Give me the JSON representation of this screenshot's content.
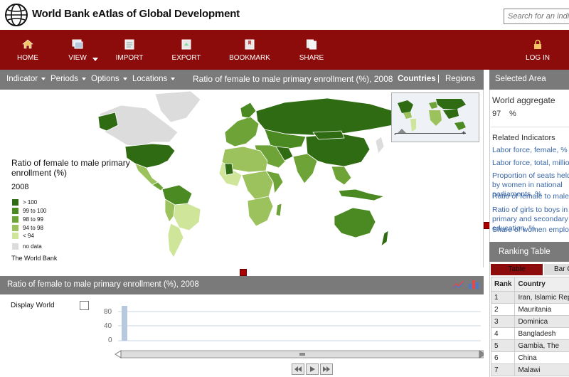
{
  "app": {
    "title": "World Bank eAtlas of Global Development",
    "search_placeholder": "Search for an indicator"
  },
  "toolbar": {
    "home": "HOME",
    "view": "VIEW",
    "import": "IMPORT",
    "export": "EXPORT",
    "bookmark": "BOOKMARK",
    "share": "SHARE",
    "login": "LOG IN"
  },
  "menubar": {
    "indicator": "Indicator",
    "periods": "Periods",
    "options": "Options",
    "locations": "Locations",
    "map_title": "Ratio of female to male primary enrollment (%), 2008",
    "countries": "Countries",
    "separator": "|",
    "regions": "Regions"
  },
  "legend": {
    "title": "Ratio of female to male primary enrollment (%)",
    "year": "2008",
    "items": [
      {
        "label": "> 100",
        "color": "#2f6b12"
      },
      {
        "label": "99 to 100",
        "color": "#4b8a22"
      },
      {
        "label": "98 to 99",
        "color": "#6ea437"
      },
      {
        "label": "94 to 98",
        "color": "#9cc25d"
      },
      {
        "label": "< 94",
        "color": "#cfe59a"
      },
      {
        "label": "no data",
        "color": "#dcdcdc"
      }
    ],
    "credit": "The World Bank"
  },
  "bottom_panel": {
    "title": "Ratio of female to male primary enrollment (%), 2008",
    "display_world": "Display World",
    "y_ticks": [
      "80",
      "40",
      "0"
    ]
  },
  "right_panel": {
    "selected_area_title": "Selected Area",
    "area_name": "World aggregate",
    "area_value": "97",
    "area_unit": "%",
    "related_title": "Related Indicators",
    "related": [
      "Labor force, female, %",
      "Labor force, total, million",
      "Proportion of seats held by women in national parliaments, %",
      "Ratio of female to male secondary",
      "Ratio of girls to boys in primary and secondary education, %",
      "Share of women employed"
    ],
    "ranking_title": "Ranking Table",
    "tab_table": "Table",
    "tab_bar": "Bar Chart",
    "columns": [
      "Rank",
      "Country"
    ],
    "rows": [
      [
        "1",
        "Iran, Islamic Rep."
      ],
      [
        "2",
        "Mauritania"
      ],
      [
        "3",
        "Dominica"
      ],
      [
        "4",
        "Bangladesh"
      ],
      [
        "5",
        "Gambia, The"
      ],
      [
        "6",
        "China"
      ],
      [
        "7",
        "Malawi"
      ]
    ]
  },
  "colors": {
    "toolbar_red": "#8c0c0c",
    "bar_grey": "#7a7a7a",
    "link_blue": "#3a67a8"
  }
}
